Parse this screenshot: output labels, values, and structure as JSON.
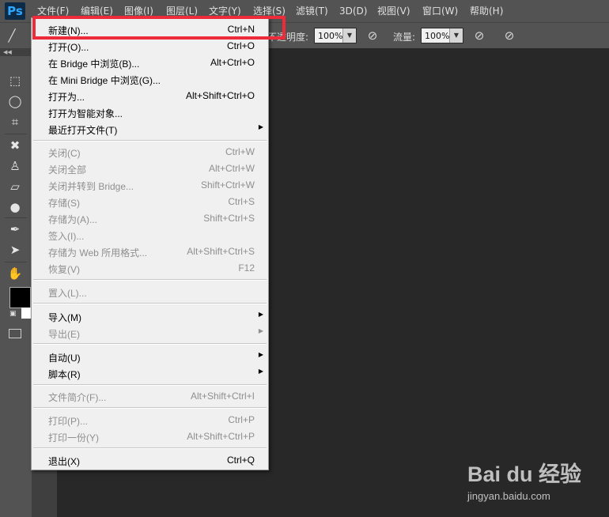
{
  "menubar": {
    "logo": "Ps",
    "items": [
      "文件(F)",
      "编辑(E)",
      "图像(I)",
      "图层(L)",
      "文字(Y)",
      "选择(S)",
      "滤镜(T)",
      "3D(D)",
      "视图(V)",
      "窗口(W)",
      "帮助(H)"
    ]
  },
  "options": {
    "opacity_label": "不透明度:",
    "opacity_value": "100%",
    "flow_label": "流量:",
    "flow_value": "100%"
  },
  "file_menu": {
    "items": [
      {
        "label": "新建(N)...",
        "shortcut": "Ctrl+N",
        "enabled": true
      },
      {
        "label": "打开(O)...",
        "shortcut": "Ctrl+O",
        "enabled": true
      },
      {
        "label": "在 Bridge 中浏览(B)...",
        "shortcut": "Alt+Ctrl+O",
        "enabled": true
      },
      {
        "label": "在 Mini Bridge 中浏览(G)...",
        "shortcut": "",
        "enabled": true
      },
      {
        "label": "打开为...",
        "shortcut": "Alt+Shift+Ctrl+O",
        "enabled": true
      },
      {
        "label": "打开为智能对象...",
        "shortcut": "",
        "enabled": true
      },
      {
        "label": "最近打开文件(T)",
        "shortcut": "",
        "enabled": true,
        "submenu": true
      },
      {
        "label": "关闭(C)",
        "shortcut": "Ctrl+W",
        "enabled": false
      },
      {
        "label": "关闭全部",
        "shortcut": "Alt+Ctrl+W",
        "enabled": false
      },
      {
        "label": "关闭并转到 Bridge...",
        "shortcut": "Shift+Ctrl+W",
        "enabled": false
      },
      {
        "label": "存储(S)",
        "shortcut": "Ctrl+S",
        "enabled": false
      },
      {
        "label": "存储为(A)...",
        "shortcut": "Shift+Ctrl+S",
        "enabled": false
      },
      {
        "label": "签入(I)...",
        "shortcut": "",
        "enabled": false
      },
      {
        "label": "存储为 Web 所用格式...",
        "shortcut": "Alt+Shift+Ctrl+S",
        "enabled": false
      },
      {
        "label": "恢复(V)",
        "shortcut": "F12",
        "enabled": false
      },
      {
        "label": "置入(L)...",
        "shortcut": "",
        "enabled": false
      },
      {
        "label": "导入(M)",
        "shortcut": "",
        "enabled": true,
        "submenu": true
      },
      {
        "label": "导出(E)",
        "shortcut": "",
        "enabled": false,
        "submenu": true
      },
      {
        "label": "自动(U)",
        "shortcut": "",
        "enabled": true,
        "submenu": true
      },
      {
        "label": "脚本(R)",
        "shortcut": "",
        "enabled": true,
        "submenu": true
      },
      {
        "label": "文件简介(F)...",
        "shortcut": "Alt+Shift+Ctrl+I",
        "enabled": false
      },
      {
        "label": "打印(P)...",
        "shortcut": "Ctrl+P",
        "enabled": false
      },
      {
        "label": "打印一份(Y)",
        "shortcut": "Alt+Shift+Ctrl+P",
        "enabled": false
      },
      {
        "label": "退出(X)",
        "shortcut": "Ctrl+Q",
        "enabled": true
      }
    ]
  },
  "watermark": {
    "logo": "Bai du 经验",
    "url": "jingyan.baidu.com"
  },
  "colors": {
    "highlight": "#ed2b3b",
    "foreground_swatch": "#000000",
    "background_swatch": "#ffffff"
  },
  "toolbar_icons": [
    "marquee-icon",
    "lasso-icon",
    "crop-icon",
    "healing-brush-icon",
    "stamp-icon",
    "eraser-icon",
    "blur-drop-icon",
    "pen-icon",
    "path-select-icon",
    "hand-icon"
  ]
}
